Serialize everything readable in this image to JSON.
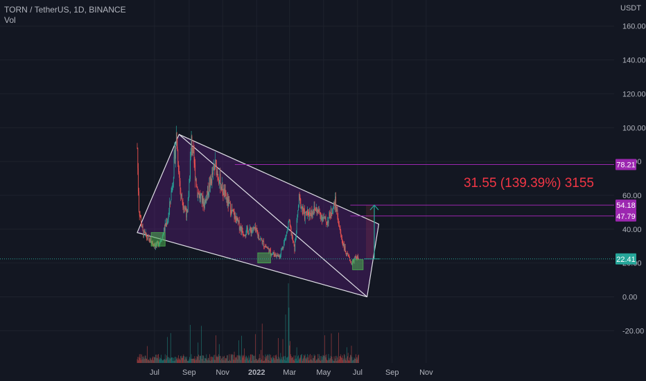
{
  "header": {
    "symbol": "TORN / TetherUS, 1D, BINANCE",
    "volume_label": "Vol"
  },
  "colors": {
    "background": "#131722",
    "grid": "#1e222d",
    "up": "#26a69a",
    "down": "#ef5350",
    "channel_fill": "#7b1fa2",
    "channel_line": "#e1e1e8",
    "level_line": "#9c27b0",
    "projection_text": "#f23645",
    "current_price": "#26a69a",
    "box_fill": "#4caf50"
  },
  "chart_data": {
    "type": "candlestick",
    "title": "TORN / TetherUS, 1D, BINANCE",
    "currency": "USDT",
    "ylim": [
      -31,
      172
    ],
    "y_ticks": [
      "160.00",
      "140.00",
      "120.00",
      "100.00",
      "80.00",
      "60.00",
      "40.00",
      "20.00",
      "0.00",
      "-20.00"
    ],
    "y_tick_values": [
      160,
      140,
      120,
      100,
      80,
      60,
      40,
      20,
      0,
      -20
    ],
    "x_ticks": [
      "Jul",
      "Sep",
      "Nov",
      "2022",
      "Mar",
      "May",
      "Jul",
      "Sep",
      "Nov"
    ],
    "x_tick_days": [
      31,
      93,
      153,
      214,
      273,
      334,
      395,
      457,
      518
    ],
    "x_range_days": [
      0,
      538
    ],
    "price_path": [
      {
        "day": 0,
        "price": 88
      },
      {
        "day": 3,
        "price": 52
      },
      {
        "day": 10,
        "price": 38
      },
      {
        "day": 20,
        "price": 34
      },
      {
        "day": 35,
        "price": 30
      },
      {
        "day": 45,
        "price": 36
      },
      {
        "day": 56,
        "price": 48
      },
      {
        "day": 64,
        "price": 70
      },
      {
        "day": 70,
        "price": 95
      },
      {
        "day": 78,
        "price": 60
      },
      {
        "day": 90,
        "price": 48
      },
      {
        "day": 97,
        "price": 92
      },
      {
        "day": 108,
        "price": 62
      },
      {
        "day": 120,
        "price": 55
      },
      {
        "day": 140,
        "price": 78
      },
      {
        "day": 152,
        "price": 64
      },
      {
        "day": 170,
        "price": 50
      },
      {
        "day": 190,
        "price": 38
      },
      {
        "day": 210,
        "price": 40
      },
      {
        "day": 225,
        "price": 32
      },
      {
        "day": 240,
        "price": 26
      },
      {
        "day": 255,
        "price": 24
      },
      {
        "day": 265,
        "price": 34
      },
      {
        "day": 272,
        "price": 44
      },
      {
        "day": 282,
        "price": 28
      },
      {
        "day": 290,
        "price": 58
      },
      {
        "day": 300,
        "price": 48
      },
      {
        "day": 320,
        "price": 52
      },
      {
        "day": 340,
        "price": 44
      },
      {
        "day": 355,
        "price": 56
      },
      {
        "day": 365,
        "price": 36
      },
      {
        "day": 375,
        "price": 25
      },
      {
        "day": 385,
        "price": 20
      },
      {
        "day": 393,
        "price": 24
      },
      {
        "day": 397,
        "price": 22
      }
    ],
    "channel_upper": [
      {
        "day": 75,
        "price": 96
      },
      {
        "day": 433,
        "price": 43
      }
    ],
    "channel_lower": [
      {
        "day": 0,
        "price": 38
      },
      {
        "day": 412,
        "price": 0
      }
    ],
    "diagonal": [
      {
        "day": 75,
        "price": 96
      },
      {
        "day": 412,
        "price": 0
      }
    ],
    "boxes": [
      {
        "day0": 25,
        "day1": 50,
        "p0": 30,
        "p1": 38
      },
      {
        "day0": 216,
        "day1": 239,
        "p0": 20,
        "p1": 26
      },
      {
        "day0": 386,
        "day1": 405,
        "p0": 16,
        "p1": 22
      }
    ],
    "levels": [
      {
        "value": 78.21,
        "label": "78.21",
        "day_start": 175
      },
      {
        "value": 54.18,
        "label": "54.18",
        "day_start": 382
      },
      {
        "value": 47.79,
        "label": "47.79",
        "day_start": 382
      }
    ],
    "current_price": 22.41,
    "current_price_label": "22.41",
    "projection": {
      "day": 425,
      "from": 22.41,
      "to": 54.18,
      "label": "31.55 (139.39%) 3155"
    }
  }
}
